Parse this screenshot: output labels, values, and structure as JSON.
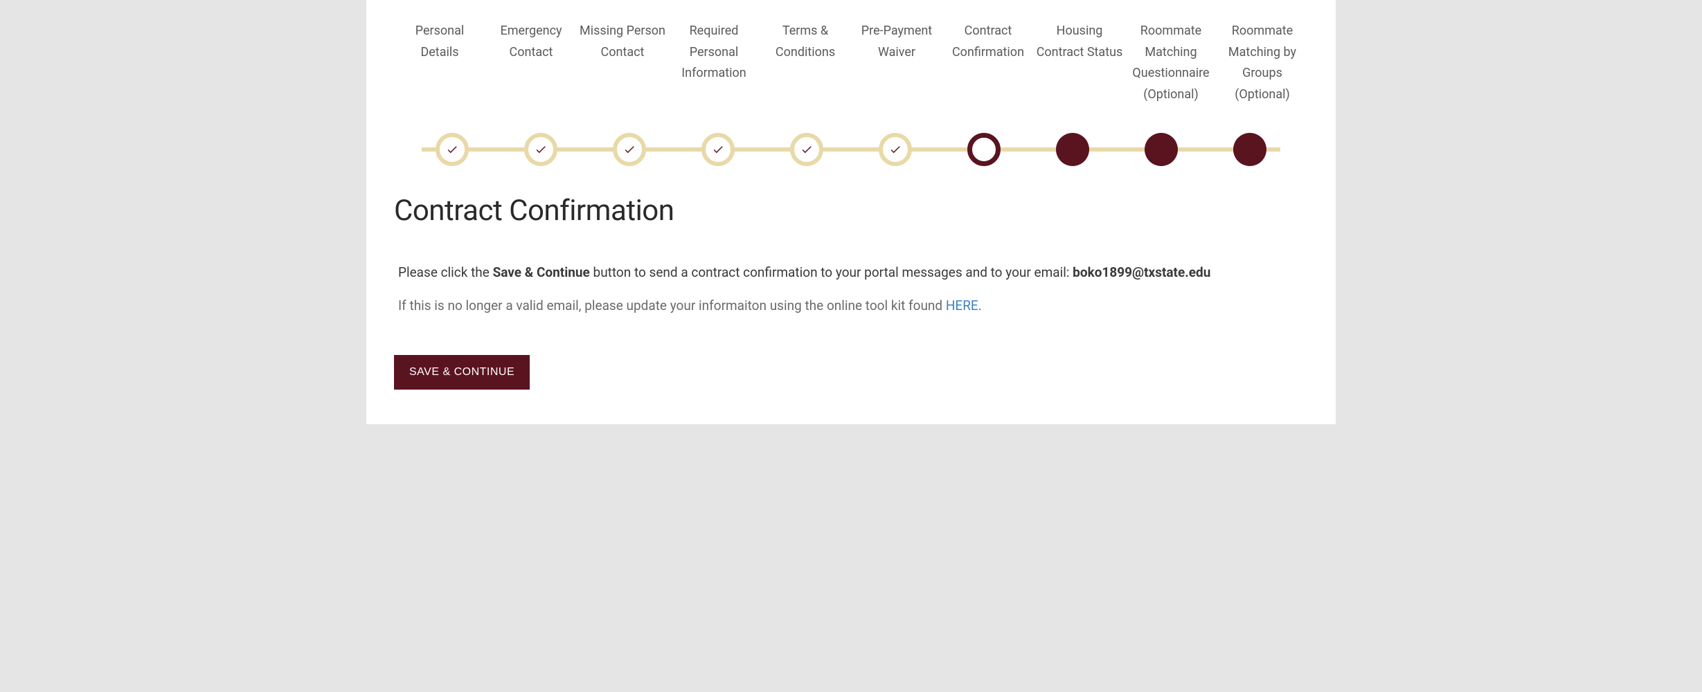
{
  "steps": [
    {
      "label": "Personal Details",
      "state": "completed"
    },
    {
      "label": "Emergency Contact",
      "state": "completed"
    },
    {
      "label": "Missing Person Contact",
      "state": "completed"
    },
    {
      "label": "Required Personal Information",
      "state": "completed"
    },
    {
      "label": "Terms & Conditions",
      "state": "completed"
    },
    {
      "label": "Pre-Payment Waiver",
      "state": "completed"
    },
    {
      "label": "Contract Confirmation",
      "state": "current"
    },
    {
      "label": "Housing Contract Status",
      "state": "future"
    },
    {
      "label": "Roommate Matching Questionnaire (Optional)",
      "state": "future"
    },
    {
      "label": "Roommate Matching by Groups (Optional)",
      "state": "future"
    }
  ],
  "page": {
    "title": "Contract Confirmation",
    "intro_pre": "Please click the ",
    "intro_bold1": "Save & Continue",
    "intro_mid": " button to send a contract confirmation to your portal messages and to your email: ",
    "intro_email": "boko1899@txstate.edu",
    "sub_pre": "If this is no longer a valid email, please update your informaiton using the online tool kit found ",
    "sub_link": "HERE",
    "sub_post": "."
  },
  "buttons": {
    "save": "SAVE & CONTINUE"
  }
}
